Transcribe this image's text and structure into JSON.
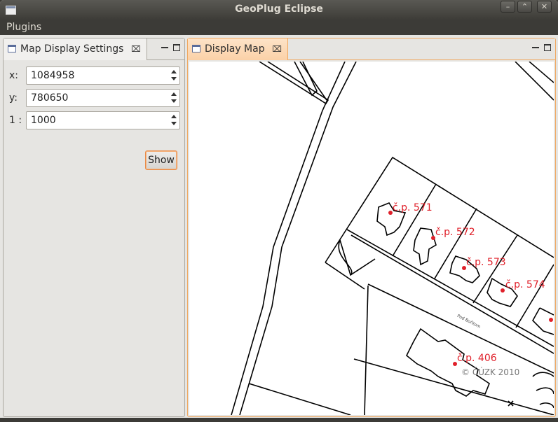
{
  "window": {
    "title": "GeoPlug Eclipse",
    "controls": [
      "minimize-icon",
      "maximize-icon",
      "close-icon"
    ]
  },
  "menubar": {
    "items": [
      "Plugins"
    ]
  },
  "settings_panel": {
    "tab_label": "Map Display Settings",
    "fields": [
      {
        "label": "x:",
        "value": "1084958"
      },
      {
        "label": "y:",
        "value": "780650"
      },
      {
        "label": "1 :",
        "value": "1000"
      }
    ],
    "show_button": "Show"
  },
  "map_panel": {
    "tab_label": "Display Map",
    "labels": [
      "č.p. 571",
      "č.p. 572",
      "č.p. 573",
      "č.p. 574",
      "č.p. 406"
    ],
    "street_label": "Pod Bořitom",
    "copyright": "© ČÚZK 2010"
  },
  "colors": {
    "label_red": "#e0202a",
    "active_tab_border": "#f0a860"
  }
}
